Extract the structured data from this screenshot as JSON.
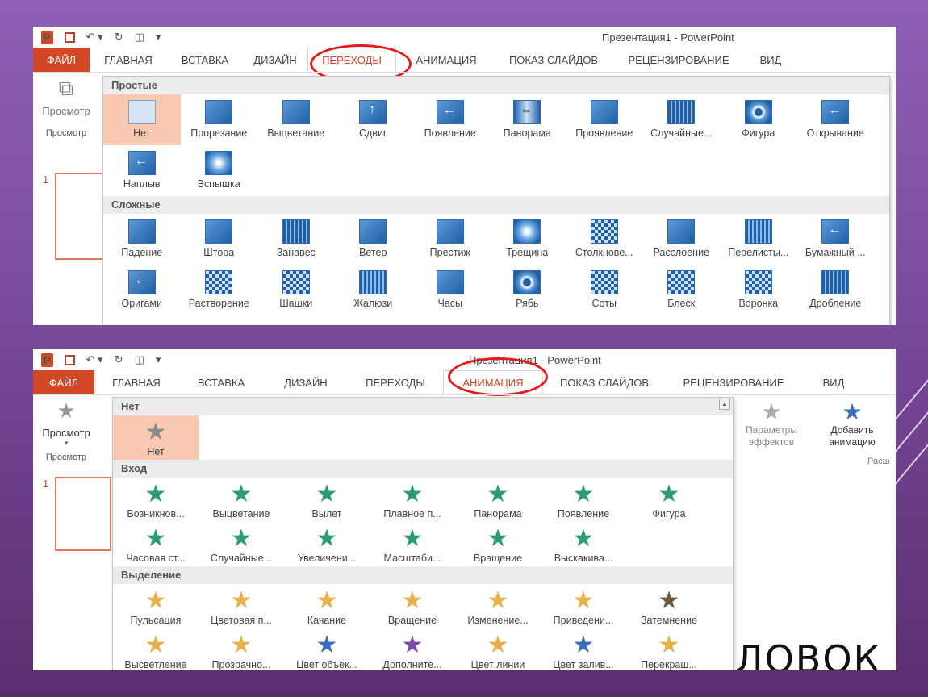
{
  "window_title": "Презентация1 - PowerPoint",
  "window_title_partial": "Презентация1 - PowerPoint",
  "ribbon_tabs_top": [
    "ФАЙЛ",
    "ГЛАВНАЯ",
    "ВСТАВКА",
    "ДИЗАЙН",
    "ПЕРЕХОДЫ",
    "АНИМАЦИЯ",
    "ПОКАЗ СЛАЙДОВ",
    "РЕЦЕНЗИРОВАНИЕ",
    "ВИД"
  ],
  "ribbon_tabs_bottom": [
    "ФАЙЛ",
    "ГЛАВНАЯ",
    "ВСТАВКА",
    "ДИЗАЙН",
    "ПЕРЕХОДЫ",
    "АНИМАЦИЯ",
    "ПОКАЗ СЛАЙДОВ",
    "РЕЦЕНЗИРОВАНИЕ",
    "ВИД"
  ],
  "active_tab_top": "ПЕРЕХОДЫ",
  "active_tab_bottom": "АНИМАЦИЯ",
  "preview": {
    "button": "Просмотр",
    "group": "Просмотр"
  },
  "slide_number": "1",
  "transitions": {
    "simple_header": "Простые",
    "simple": [
      "Нет",
      "Прорезание",
      "Выцветание",
      "Сдвиг",
      "Появление",
      "Панорама",
      "Проявление",
      "Случайные...",
      "Фигура",
      "Открывание",
      "Наплыв",
      "Вспышка"
    ],
    "complex_header": "Сложные",
    "complex": [
      "Падение",
      "Штора",
      "Занавес",
      "Ветер",
      "Престиж",
      "Трещина",
      "Столкнове...",
      "Расслоение",
      "Перелисты...",
      "Бумажный ...",
      "Оригами",
      "Растворение",
      "Шашки",
      "Жалюзи",
      "Часы",
      "Рябь",
      "Соты",
      "Блеск",
      "Воронка",
      "Дробление"
    ]
  },
  "animations": {
    "none_header": "Нет",
    "none": [
      "Нет"
    ],
    "entrance_header": "Вход",
    "entrance": [
      "Возникнов...",
      "Выцветание",
      "Вылет",
      "Плавное п...",
      "Панорама",
      "Появление",
      "Фигура",
      "Часовая ст...",
      "Случайные...",
      "Увеличени...",
      "Масштаби...",
      "Вращение",
      "Выскакива..."
    ],
    "emphasis_header": "Выделение",
    "emphasis": [
      "Пульсация",
      "Цветовая п...",
      "Качание",
      "Вращение",
      "Изменение...",
      "Приведени...",
      "Затемнение",
      "Высветление",
      "Прозрачно...",
      "Цвет объек...",
      "Дополните...",
      "Цвет линии",
      "Цвет залив...",
      "Перекраш..."
    ]
  },
  "effect_options": "Параметры эффектов",
  "add_animation": "Добавить анимацию",
  "extended_group": "Расш",
  "slide_title_fragment": "ЛОВОК",
  "colors": {
    "accent": "#d24726",
    "highlight_ring": "#e41b1b",
    "selected_item": "#f9c8b0"
  }
}
